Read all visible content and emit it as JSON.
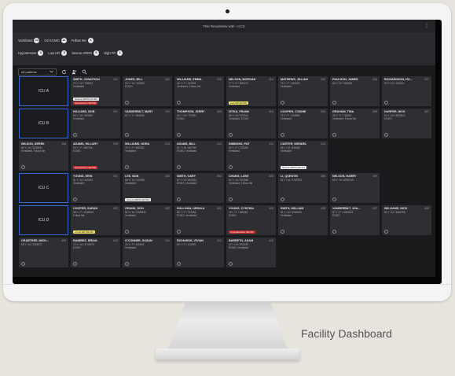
{
  "caption": "Facility Dashboard",
  "window": {
    "title": "Tele RenalView with +ACS"
  },
  "filters": {
    "row1": [
      {
        "label": "Ventilated",
        "count": "14"
      },
      {
        "label": "On ECMO",
        "count": "12"
      },
      {
        "label": "Follow Me",
        "count": "3"
      }
    ],
    "row2": [
      {
        "label": "Hypotension",
        "count": "3"
      },
      {
        "label": "Low HR",
        "count": "3"
      },
      {
        "label": "Severe ARDS",
        "count": "6"
      },
      {
        "label": "High FP",
        "count": "1"
      }
    ]
  },
  "toolbar": {
    "select_value": "All patients"
  },
  "units": [
    "ICU A",
    "ICU B",
    "ICU C",
    "ICU D"
  ],
  "patients": [
    {
      "name": "SMITH, JONATHON",
      "room": "201",
      "info": "75 Y / M / 738813",
      "status": "Ventilated",
      "alert": "Hypotension (02:54)",
      "alert_type": "red",
      "alert2": "Severe ARDS (02:48)",
      "alert2_type": "wht"
    },
    {
      "name": "JONES, BILL",
      "room": "202",
      "info": "93 Y / M / 184392",
      "status": "ECMO"
    },
    {
      "name": "WILLIAMS, EMMA",
      "room": "203",
      "info": "46 Y / F / 123394",
      "status": "Ventilated, Follow Me"
    },
    {
      "name": "NELSON, MORGAN",
      "room": "204",
      "info": "77 Y / F / 828479",
      "status": "Ventilated",
      "alert": "Low HR (02:56)",
      "alert_type": "yel"
    },
    {
      "name": "MATHEWS, JILLIAN",
      "room": "205",
      "info": "76 Y / F / 343453",
      "status": "Ventilated"
    },
    {
      "name": "PAULSON, JAMES",
      "room": "206",
      "info": "66 Y / M / 388394",
      "status": ""
    },
    {
      "name": "RICHARDSON, HO...",
      "room": "207",
      "info": "93 Y / M / 435163",
      "status": ""
    },
    {
      "name": "HILLIARD, BOB",
      "room": "301",
      "info": "83 Y / M / 305392",
      "status": "Ventilated"
    },
    {
      "name": "VANDERBILT, MARY",
      "room": "302",
      "info": "87 Y / F / 343009",
      "status": ""
    },
    {
      "name": "THOMPSON, JERRY",
      "room": "303",
      "info": "44 Y / M / 753391",
      "status": "ECMO"
    },
    {
      "name": "DITKA, FRANK",
      "room": "304",
      "info": "68 Y / M / 309312",
      "status": "Ventilated, ECMO"
    },
    {
      "name": "COOPER, CONNIE",
      "room": "305",
      "info": "75 Y / F / 913884",
      "status": "Ventilated"
    },
    {
      "name": "GRAHAM, TINA",
      "room": "306",
      "info": "38 Y / F / 718281",
      "status": "Ventilated, Follow Me"
    },
    {
      "name": "HARPER, NICK",
      "room": "307",
      "info": "92 Y / M / 9823421",
      "status": "ECMO"
    },
    {
      "name": "WILSON, DEREK",
      "room": "208",
      "info": "89 Y / M / 3208342",
      "status": "Ventilated, Follow Me"
    },
    {
      "name": "ADAMS, HILLARY",
      "room": "209",
      "info": "53 Y / F / 982718",
      "status": "ECMO",
      "alert": "Hypotension (02:50)",
      "alert_type": "red"
    },
    {
      "name": "WILLIAMS, NORA",
      "room": "210",
      "info": "75 Y / F / 845392",
      "status": "Ventilated"
    },
    {
      "name": "ADAMS, BILL",
      "room": "211",
      "info": "81 Y / M / 887390",
      "status": "ECMO, Ventilated"
    },
    {
      "name": "SIMMONS, PAT",
      "room": "212",
      "info": "53 Y / F / 723096",
      "status": "Ventilated"
    },
    {
      "name": "CARTER, WENDEL",
      "room": "213",
      "info": "85 Y / M / 336382",
      "status": "Ventilated",
      "alert": "Severe ARDS (02:47)",
      "alert_type": "wht"
    },
    {
      "name": "YOUNG, ERIN",
      "room": "301",
      "info": "81 Y / M / 409233",
      "status": "Ventilated"
    },
    {
      "name": "LEE, BOB",
      "room": "303",
      "info": "58 Y / M / 340093",
      "status": "Ventilated",
      "alert": "Severe ARDS (02:58)",
      "alert_type": "wht"
    },
    {
      "name": "SMITH, GARY",
      "room": "304",
      "info": "67 Y / M / 893334",
      "status": "ECMO, Ventilated"
    },
    {
      "name": "CHANG, LUKE",
      "room": "305",
      "info": "54 Y / M / 303346",
      "status": "Ventilated, Follow Me"
    },
    {
      "name": "LI, QUENTIN",
      "room": "306",
      "info": "51 Y / M / 2783723",
      "status": ""
    },
    {
      "name": "NELSON, HARRY",
      "room": "309",
      "info": "68 Y / M / 8080745",
      "status": ""
    },
    {
      "name": "COOPER, SARAH",
      "room": "401",
      "info": "38 Y / F / 1648623",
      "status": "Follow Me",
      "alert": "Low HR (02:49)",
      "alert_type": "yel",
      "badge": "2"
    },
    {
      "name": "GRANK, DON",
      "room": "402",
      "info": "52 Y / M / 3380533",
      "status": "Ventilated"
    },
    {
      "name": "SULLIVAN, URSULA",
      "room": "403",
      "info": "86 Y / F / 723286",
      "status": "ECMO, Ventilated"
    },
    {
      "name": "YOUNG, CYNTHIA",
      "room": "405",
      "info": "76 Y / F / 585082",
      "status": "ECMO",
      "alert": "Hypotension (02:00)",
      "alert_type": "red",
      "badge": "2"
    },
    {
      "name": "SMITH, WILLIAM",
      "room": "406",
      "info": "81 Y / M / 3382005",
      "status": "Ventilated"
    },
    {
      "name": "VANDERBILT, JOA...",
      "room": "407",
      "info": "87 Y / F / 1683023",
      "status": "ECMO"
    },
    {
      "name": "WILLIAMS, NICK",
      "room": "408",
      "info": "84 Y / M / 3880755",
      "status": ""
    },
    {
      "name": "CRABTREE, MICH...",
      "room": "409",
      "info": "95 Y / M / 2265271",
      "status": ""
    },
    {
      "name": "RAMIREZ, BRIAN",
      "room": "410",
      "info": "72 Y / M / 2749279",
      "status": "ECMO"
    },
    {
      "name": "O'CONNER, SUSAN",
      "room": "411",
      "info": "75 Y / F / 149592",
      "status": "Ventilated"
    },
    {
      "name": "RICHARDS, VIVIAN",
      "room": "412",
      "info": "62 Y / F / 123992",
      "status": ""
    },
    {
      "name": "BARRETO, ADAM",
      "room": "412",
      "info": "43 Y / M / 59323F",
      "status": "ECMO, Ventilated"
    }
  ],
  "colors": {
    "unit_border": "#3b6ad8",
    "alert_red": "#c62a2a",
    "alert_yellow": "#f2e36a"
  },
  "icons": [
    "hamburger-menu-icon",
    "chevron-down-icon",
    "refresh-icon",
    "people-icon",
    "search-icon",
    "info-circle-icon"
  ]
}
